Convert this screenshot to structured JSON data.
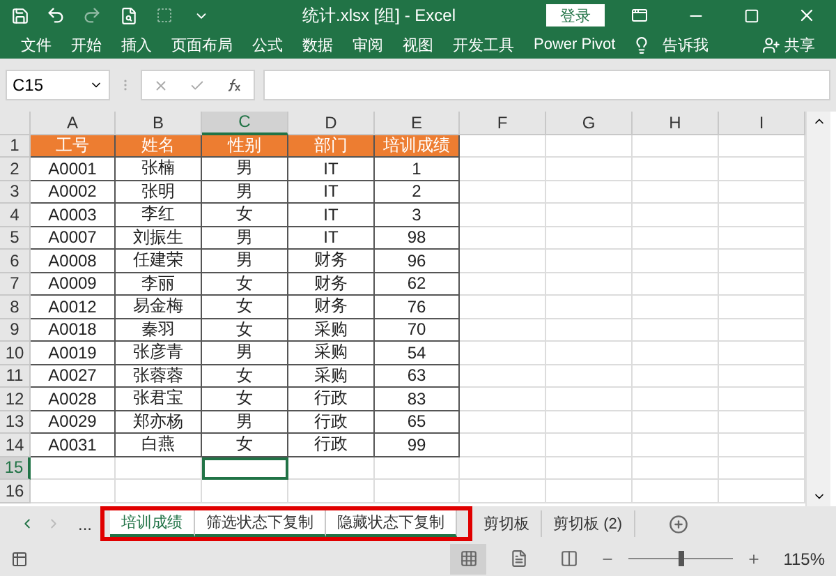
{
  "title_bar": {
    "title": "统计.xlsx  [组]  -  Excel",
    "login": "登录"
  },
  "ribbon": {
    "tabs": [
      "文件",
      "开始",
      "插入",
      "页面布局",
      "公式",
      "数据",
      "审阅",
      "视图",
      "开发工具",
      "Power Pivot"
    ],
    "tell_me": "告诉我",
    "share": "共享"
  },
  "formula_bar": {
    "name_box": "C15"
  },
  "grid": {
    "columns": [
      {
        "label": "A",
        "selected": false
      },
      {
        "label": "B",
        "selected": false
      },
      {
        "label": "C",
        "selected": true
      },
      {
        "label": "D",
        "selected": false
      },
      {
        "label": "E",
        "selected": false
      },
      {
        "label": "F",
        "selected": false
      },
      {
        "label": "G",
        "selected": false
      },
      {
        "label": "H",
        "selected": false
      },
      {
        "label": "I",
        "selected": false
      }
    ],
    "rows": [
      {
        "label": "1",
        "selected": false,
        "kind": "header",
        "cells": [
          "工号",
          "姓名",
          "性别",
          "部门",
          "培训成绩"
        ]
      },
      {
        "label": "2",
        "selected": false,
        "kind": "data",
        "cells": [
          "A0001",
          "张楠",
          "男",
          "IT",
          "1"
        ]
      },
      {
        "label": "3",
        "selected": false,
        "kind": "data",
        "cells": [
          "A0002",
          "张明",
          "男",
          "IT",
          "2"
        ]
      },
      {
        "label": "4",
        "selected": false,
        "kind": "data",
        "cells": [
          "A0003",
          "李红",
          "女",
          "IT",
          "3"
        ]
      },
      {
        "label": "5",
        "selected": false,
        "kind": "data",
        "cells": [
          "A0007",
          "刘振生",
          "男",
          "IT",
          "98"
        ]
      },
      {
        "label": "6",
        "selected": false,
        "kind": "data",
        "cells": [
          "A0008",
          "任建荣",
          "男",
          "财务",
          "96"
        ]
      },
      {
        "label": "7",
        "selected": false,
        "kind": "data",
        "cells": [
          "A0009",
          "李丽",
          "女",
          "财务",
          "62"
        ]
      },
      {
        "label": "8",
        "selected": false,
        "kind": "data",
        "cells": [
          "A0012",
          "易金梅",
          "女",
          "财务",
          "76"
        ]
      },
      {
        "label": "9",
        "selected": false,
        "kind": "data",
        "cells": [
          "A0018",
          "秦羽",
          "女",
          "采购",
          "70"
        ]
      },
      {
        "label": "10",
        "selected": false,
        "kind": "data",
        "cells": [
          "A0019",
          "张彦青",
          "男",
          "采购",
          "54"
        ]
      },
      {
        "label": "11",
        "selected": false,
        "kind": "data",
        "cells": [
          "A0027",
          "张蓉蓉",
          "女",
          "采购",
          "63"
        ]
      },
      {
        "label": "12",
        "selected": false,
        "kind": "data",
        "cells": [
          "A0028",
          "张君宝",
          "女",
          "行政",
          "83"
        ]
      },
      {
        "label": "13",
        "selected": false,
        "kind": "data",
        "cells": [
          "A0029",
          "郑亦杨",
          "男",
          "行政",
          "65"
        ]
      },
      {
        "label": "14",
        "selected": false,
        "kind": "data",
        "cells": [
          "A0031",
          "白燕",
          "女",
          "行政",
          "99"
        ]
      },
      {
        "label": "15",
        "selected": true,
        "kind": "empty",
        "cells": []
      },
      {
        "label": "16",
        "selected": false,
        "kind": "empty",
        "cells": []
      }
    ]
  },
  "sheet_tabs": {
    "more": "...",
    "tabs": [
      {
        "label": "培训成绩",
        "selected": true,
        "grouped": true,
        "highlighted": true
      },
      {
        "label": "筛选状态下复制",
        "selected": false,
        "grouped": true,
        "highlighted": true
      },
      {
        "label": "隐藏状态下复制",
        "selected": false,
        "grouped": true,
        "highlighted": true
      },
      {
        "label": "剪切板",
        "selected": false,
        "grouped": false,
        "highlighted": false
      },
      {
        "label": "剪切板 (2)",
        "selected": false,
        "grouped": false,
        "highlighted": false
      }
    ]
  },
  "status_bar": {
    "views": [
      {
        "selected": true
      },
      {
        "selected": false
      },
      {
        "selected": false
      }
    ],
    "zoom": {
      "level": 0.5,
      "reading": "115%"
    }
  }
}
